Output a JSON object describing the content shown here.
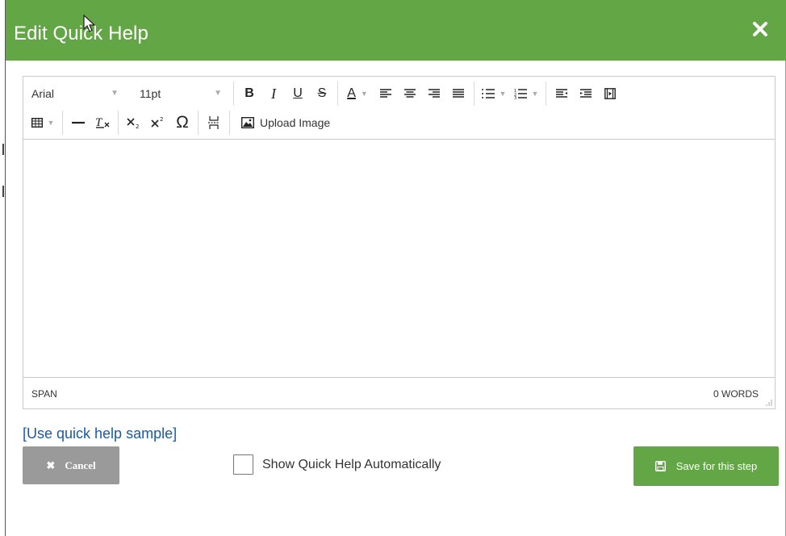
{
  "dialog": {
    "title": "Edit Quick Help"
  },
  "toolbar": {
    "font_family": "Arial",
    "font_size": "11pt",
    "icons": [
      "bold-icon",
      "italic-icon",
      "underline-icon",
      "strikethrough-icon",
      "text-color-icon",
      "align-left-icon",
      "align-center-icon",
      "align-right-icon",
      "align-justify-icon",
      "bullet-list-icon",
      "numbered-list-icon",
      "outdent-icon",
      "indent-icon",
      "media-icon",
      "table-icon",
      "horizontal-rule-icon",
      "clear-formatting-icon",
      "subscript-icon",
      "superscript-icon",
      "special-character-icon",
      "page-break-icon",
      "image-icon"
    ],
    "bold": "B",
    "italic": "I",
    "underline": "U",
    "strike": "S",
    "text_color": "A",
    "omega": "Ω",
    "upload_label": "Upload Image"
  },
  "statusbar": {
    "path": "SPAN",
    "word_count": "0 WORDS"
  },
  "footer": {
    "sample_link": "[Use quick help sample]",
    "cancel_label": "Cancel",
    "checkbox_label": "Show Quick Help Automatically",
    "checkbox_checked": false,
    "save_label": "Save for this step"
  },
  "colors": {
    "header_bg": "#63a646",
    "save_bg": "#63a646",
    "cancel_bg": "#9a9a9a",
    "link": "#1a5aa6"
  }
}
